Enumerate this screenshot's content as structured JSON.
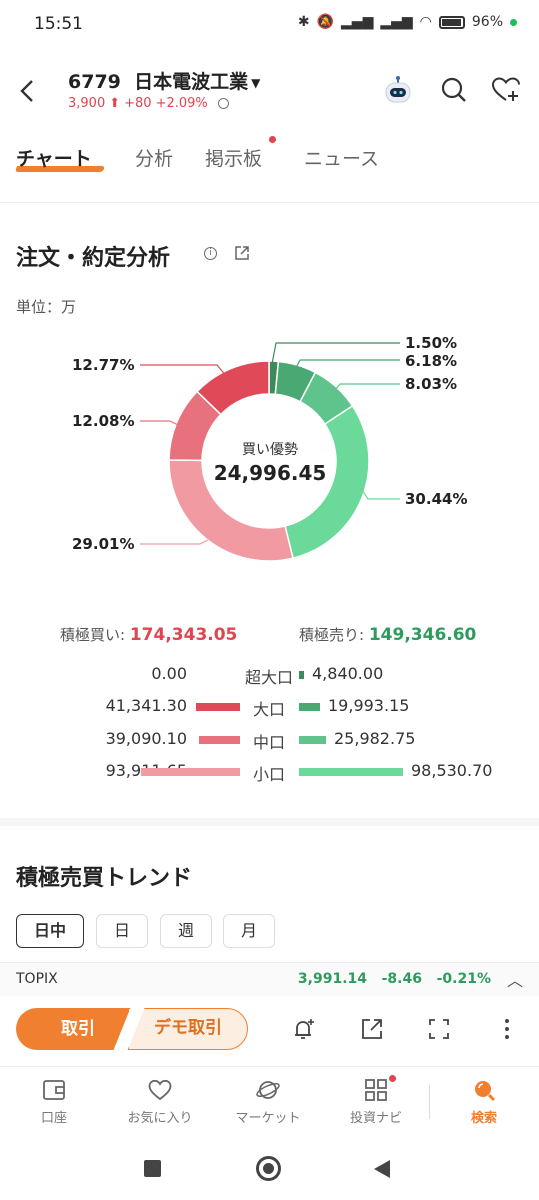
{
  "status_bar": {
    "time": "15:51",
    "battery": "96%"
  },
  "header": {
    "code": "6779",
    "name": "日本電波工業",
    "price": "3,900",
    "change": "+80",
    "change_pct": "+2.09%"
  },
  "tabs": [
    {
      "label": "チャート",
      "active": true
    },
    {
      "label": "分析",
      "active": false
    },
    {
      "label": "掲示板",
      "active": false,
      "badge": true
    },
    {
      "label": "ニュース",
      "active": false
    }
  ],
  "order_analysis": {
    "title": "注文・約定分析",
    "unit": "単位：万",
    "donut": {
      "center_label": "買い優勢",
      "center_value": "24,996.45",
      "slices": [
        {
          "name": "超大口売り",
          "pct": 1.5,
          "label": "1.50%",
          "color": "#3d8a5c"
        },
        {
          "name": "大口売り",
          "pct": 6.18,
          "label": "6.18%",
          "color": "#4aa872"
        },
        {
          "name": "中口売り",
          "pct": 8.03,
          "label": "8.03%",
          "color": "#5fc48c"
        },
        {
          "name": "小口売り",
          "pct": 30.44,
          "label": "30.44%",
          "color": "#6bd99a"
        },
        {
          "name": "小口買い",
          "pct": 29.01,
          "label": "29.01%",
          "color": "#f19aa2"
        },
        {
          "name": "中口買い",
          "pct": 12.08,
          "label": "12.08%",
          "color": "#e7727d"
        },
        {
          "name": "大口買い",
          "pct": 12.77,
          "label": "12.77%",
          "color": "#e04a58"
        }
      ]
    },
    "buy_label": "積極買い:",
    "buy_total": "174,343.05",
    "sell_label": "積極売り:",
    "sell_total": "149,346.60",
    "rows": [
      {
        "label": "超大口",
        "buy": "0.00",
        "sell": "4,840.00",
        "buy_value": 0.0,
        "sell_value": 4840.0
      },
      {
        "label": "大口",
        "buy": "41,341.30",
        "sell": "19,993.15",
        "buy_value": 41341.3,
        "sell_value": 19993.15
      },
      {
        "label": "中口",
        "buy": "39,090.10",
        "sell": "25,982.75",
        "buy_value": 39090.1,
        "sell_value": 25982.75
      },
      {
        "label": "小口",
        "buy": "93,911.65",
        "sell": "98,530.70",
        "buy_value": 93911.65,
        "sell_value": 98530.7
      }
    ],
    "buy_colors": [
      "#c94a55",
      "#e04a58",
      "#e7727d",
      "#f19aa2"
    ],
    "sell_colors": [
      "#3d8a5c",
      "#4aa872",
      "#5fc48c",
      "#6bd99a"
    ]
  },
  "trend": {
    "title": "積極売買トレンド",
    "periods": [
      {
        "label": "日中",
        "active": true
      },
      {
        "label": "日",
        "active": false
      },
      {
        "label": "週",
        "active": false
      },
      {
        "label": "月",
        "active": false
      }
    ]
  },
  "topix": {
    "name": "TOPIX",
    "value": "3,991.14",
    "change": "-8.46",
    "change_pct": "-0.21%"
  },
  "actions": {
    "trade": "取引",
    "demo": "デモ取引"
  },
  "nav": [
    {
      "label": "口座",
      "icon": "wallet-icon",
      "active": false
    },
    {
      "label": "お気に入り",
      "icon": "heart-icon",
      "active": false
    },
    {
      "label": "マーケット",
      "icon": "planet-icon",
      "active": false
    },
    {
      "label": "投資ナビ",
      "icon": "grid-icon",
      "active": false,
      "badge": true
    },
    {
      "label": "検索",
      "icon": "search-icon",
      "active": true
    }
  ]
}
